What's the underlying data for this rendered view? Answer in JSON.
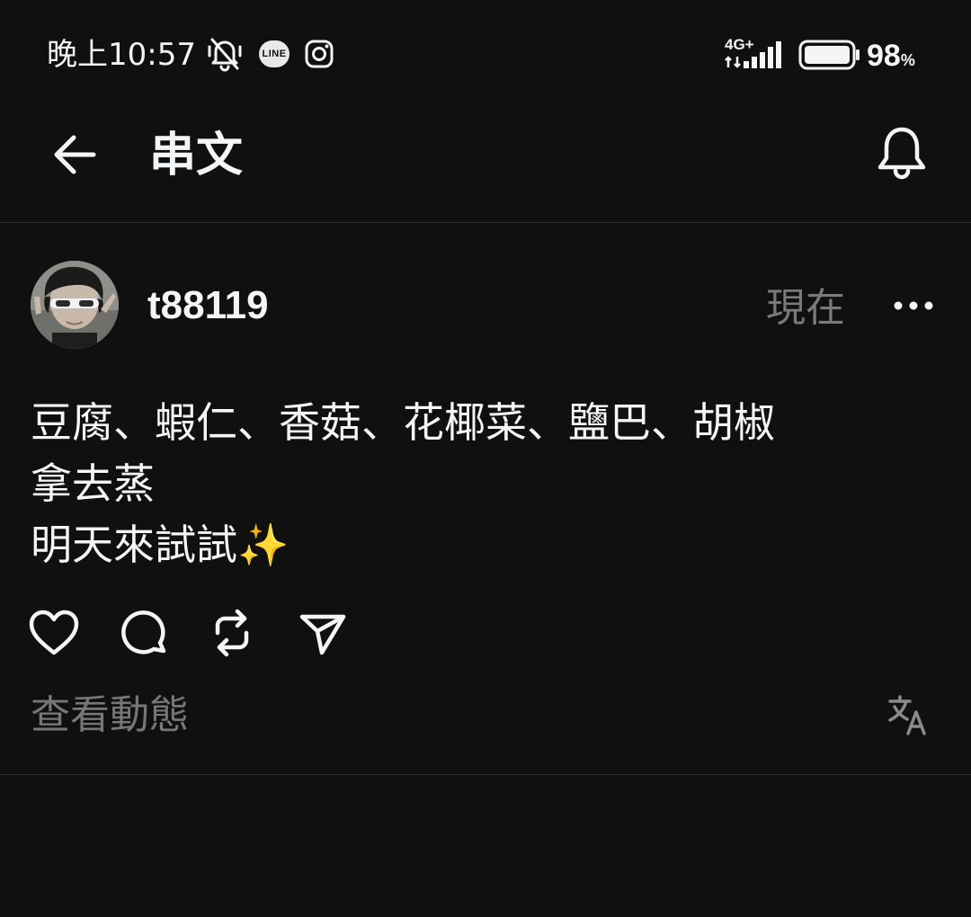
{
  "status_bar": {
    "time": "晚上10:57",
    "network": "4G+",
    "battery_percent": "98",
    "battery_unit": "%",
    "notification_icons": [
      "mute-icon",
      "line-app-icon",
      "instagram-icon"
    ],
    "line_label": "LINE"
  },
  "header": {
    "title": "串文",
    "back_icon": "arrow-left-icon",
    "notify_icon": "bell-icon"
  },
  "post": {
    "username": "t88119",
    "timestamp": "現在",
    "lines": [
      "豆腐、蝦仁、香菇、花椰菜、鹽巴、胡椒",
      "拿去蒸",
      "明天來試試✨"
    ],
    "actions": [
      "like-icon",
      "comment-icon",
      "repost-icon",
      "share-icon"
    ],
    "view_activity": "查看動態",
    "translate_icon": "translate-icon"
  },
  "colors": {
    "background": "#101010",
    "text": "#f3f5f7",
    "muted": "#777777",
    "divider": "#2d2d2d"
  }
}
